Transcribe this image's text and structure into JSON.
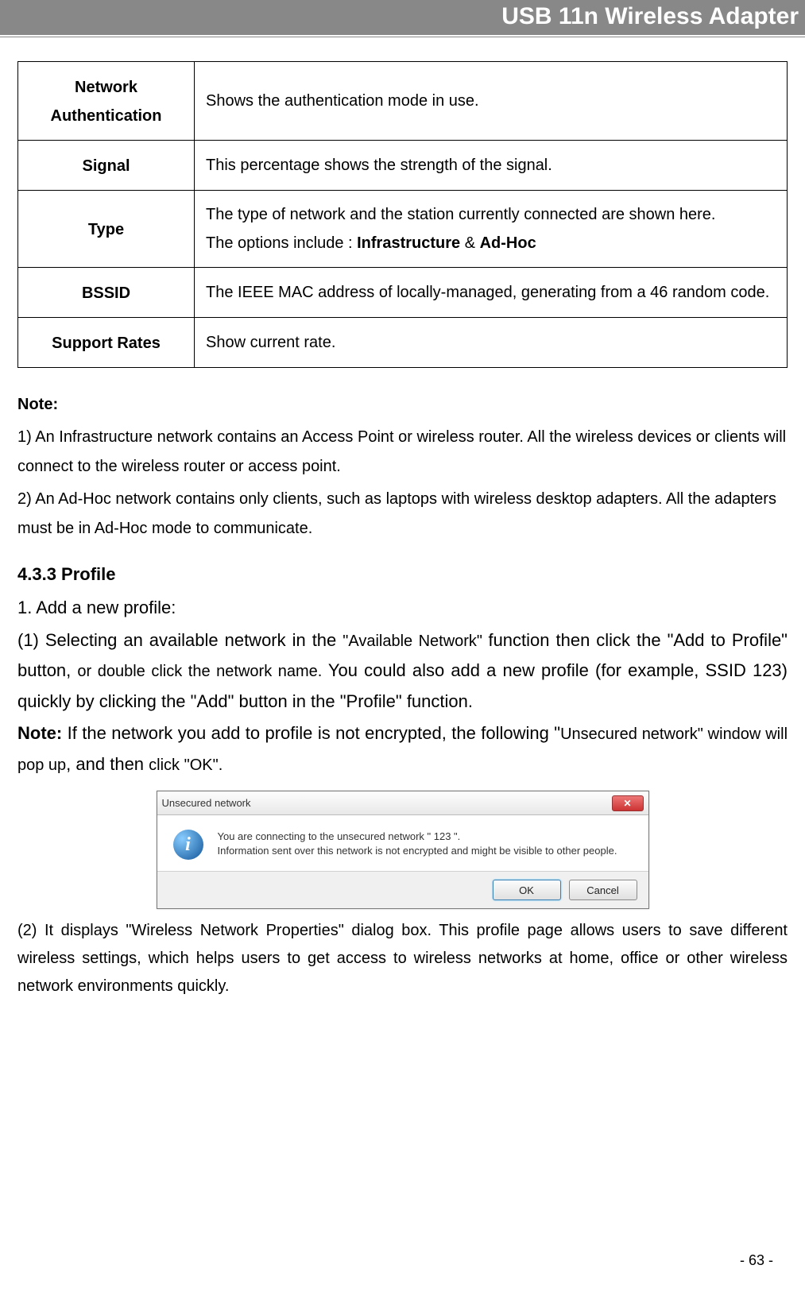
{
  "header": {
    "title": "USB 11n Wireless Adapter"
  },
  "table": {
    "rows": [
      {
        "label": "Network Authentication",
        "desc": "Shows the authentication mode in use."
      },
      {
        "label": "Signal",
        "desc": "This percentage shows the strength of the signal."
      },
      {
        "label": "Type",
        "desc_prefix": "The type of network and the station currently connected are shown here.",
        "desc_line2_prefix": "The options include : ",
        "opt1": "Infrastructure",
        "amp": " & ",
        "opt2": "Ad-Hoc"
      },
      {
        "label": "BSSID",
        "desc": "The IEEE MAC address of locally-managed, generating from a 46 random code."
      },
      {
        "label": "Support Rates",
        "desc": "Show current rate."
      }
    ]
  },
  "note": {
    "heading": "Note:",
    "line1": "1) An Infrastructure network contains an Access Point or wireless router. All the wireless devices or clients will connect to the wireless router or access point.",
    "line2": "2) An Ad-Hoc network contains only clients, such as laptops with wireless desktop adapters. All the adapters must be in Ad-Hoc mode to communicate."
  },
  "section": {
    "heading": "4.3.3    Profile",
    "p1": "1. Add a new profile:",
    "p2_a": "(1) Selecting an available network in the ",
    "p2_b": "\"Available Network\" ",
    "p2_c": "function then click the \"Add to Profile\" button, ",
    "p2_d": "or double click the network name. ",
    "p2_e": "You could also add a new profile (for example, SSID 123) quickly by clicking the \"Add\" button in the \"Profile\" function.",
    "p3_a": "Note: ",
    "p3_b": "If the network you add to profile is not encrypted, the following \"",
    "p3_c": "Unsecured network\" window will pop up",
    "p3_d": ", and then ",
    "p3_e": "click \"OK\".",
    "p4": "(2) It displays \"Wireless Network Properties\" dialog box. This profile page allows users to save different wireless settings, which helps users to get access to wireless networks at home, office or other wireless network environments quickly."
  },
  "dialog": {
    "title": "Unsecured network",
    "body_line1": "You are connecting to the unsecured network \" 123 \".",
    "body_line2": " Information sent over this network is not encrypted and might be visible to other people.",
    "ok": "OK",
    "cancel": "Cancel"
  },
  "page_number": "- 63 -"
}
